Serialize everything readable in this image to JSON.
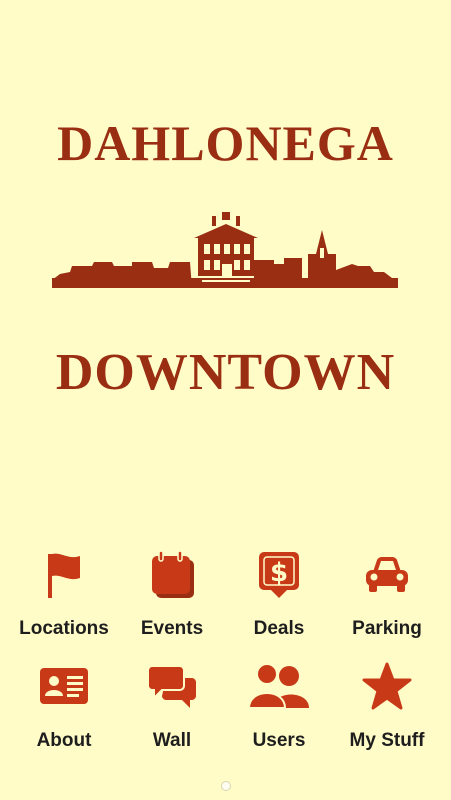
{
  "header": {
    "title_top": "DAHLONEGA",
    "title_bottom": "DOWNTOWN"
  },
  "colors": {
    "background": "#fffcc8",
    "brand": "#9a2e12",
    "icon": "#c83a17",
    "label": "#1e1e1e"
  },
  "menu": {
    "items": [
      {
        "label": "Locations",
        "icon": "flag-icon"
      },
      {
        "label": "Events",
        "icon": "calendar-icon"
      },
      {
        "label": "Deals",
        "icon": "dollar-tag-icon"
      },
      {
        "label": "Parking",
        "icon": "car-icon"
      },
      {
        "label": "About",
        "icon": "id-card-icon"
      },
      {
        "label": "Wall",
        "icon": "chat-bubbles-icon"
      },
      {
        "label": "Users",
        "icon": "users-icon"
      },
      {
        "label": "My Stuff",
        "icon": "star-icon"
      }
    ]
  },
  "pager": {
    "pages": 1,
    "current": 1
  }
}
